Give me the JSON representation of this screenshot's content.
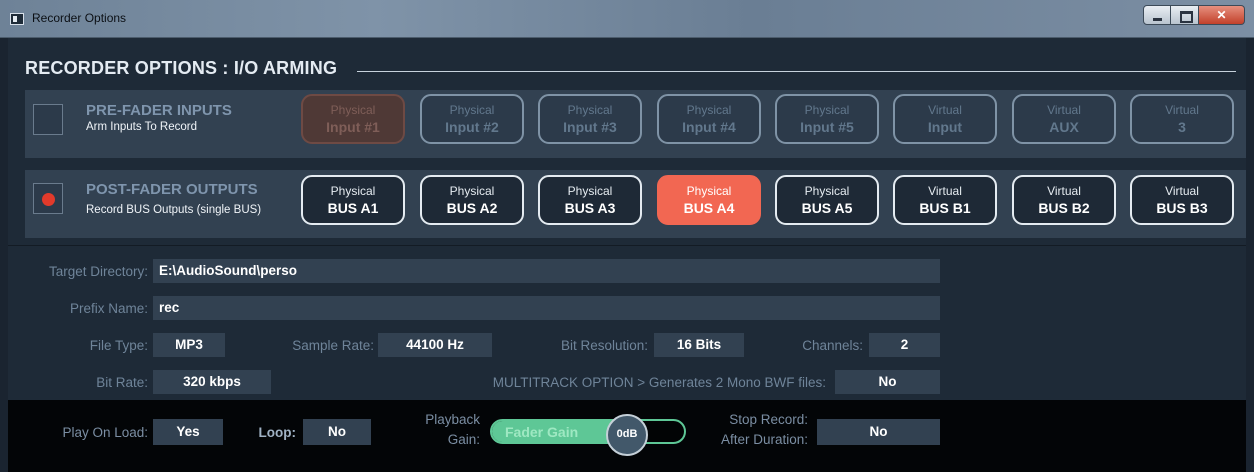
{
  "window": {
    "title": "Recorder Options"
  },
  "header": "RECORDER OPTIONS : I/O ARMING",
  "pre_fader": {
    "title": "PRE-FADER INPUTS",
    "subtitle": "Arm Inputs To Record",
    "armed": false,
    "buttons": [
      {
        "line1": "Physical",
        "line2": "Input #1",
        "state": "dim-red"
      },
      {
        "line1": "Physical",
        "line2": "Input #2",
        "state": "disabled"
      },
      {
        "line1": "Physical",
        "line2": "Input #3",
        "state": "disabled"
      },
      {
        "line1": "Physical",
        "line2": "Input #4",
        "state": "disabled"
      },
      {
        "line1": "Physical",
        "line2": "Input #5",
        "state": "disabled"
      },
      {
        "line1": "Virtual",
        "line2": "Input",
        "state": "disabled"
      },
      {
        "line1": "Virtual",
        "line2": "AUX",
        "state": "disabled"
      },
      {
        "line1": "Virtual",
        "line2": "3",
        "state": "disabled"
      }
    ]
  },
  "post_fader": {
    "title": "POST-FADER OUTPUTS",
    "subtitle": "Record BUS Outputs (single BUS)",
    "armed": true,
    "buttons": [
      {
        "line1": "Physical",
        "line2": "BUS A1",
        "state": "normal"
      },
      {
        "line1": "Physical",
        "line2": "BUS A2",
        "state": "normal"
      },
      {
        "line1": "Physical",
        "line2": "BUS A3",
        "state": "normal"
      },
      {
        "line1": "Physical",
        "line2": "BUS A4",
        "state": "active"
      },
      {
        "line1": "Physical",
        "line2": "BUS A5",
        "state": "normal"
      },
      {
        "line1": "Virtual",
        "line2": "BUS B1",
        "state": "normal"
      },
      {
        "line1": "Virtual",
        "line2": "BUS B2",
        "state": "normal"
      },
      {
        "line1": "Virtual",
        "line2": "BUS B3",
        "state": "normal"
      }
    ]
  },
  "settings": {
    "target_directory": {
      "label": "Target Directory:",
      "value": "E:\\AudioSound\\perso"
    },
    "prefix_name": {
      "label": "Prefix Name:",
      "value": "rec"
    },
    "file_type": {
      "label": "File Type:",
      "value": "MP3"
    },
    "sample_rate": {
      "label": "Sample Rate:",
      "value": "44100 Hz"
    },
    "bit_resolution": {
      "label": "Bit Resolution:",
      "value": "16 Bits"
    },
    "channels": {
      "label": "Channels:",
      "value": "2"
    },
    "bit_rate": {
      "label": "Bit Rate:",
      "value": "320 kbps"
    },
    "multitrack": {
      "label": "MULTITRACK OPTION > Generates 2 Mono BWF files:",
      "value": "No"
    }
  },
  "playback": {
    "play_on_load": {
      "label": "Play On Load:",
      "value": "Yes"
    },
    "loop": {
      "label": "Loop:",
      "value": "No"
    },
    "gain": {
      "label_line1": "Playback",
      "label_line2": "Gain:",
      "fader_label": "Fader Gain",
      "value": "0dB",
      "level": 0.7
    },
    "stop_record": {
      "label_line1": "Stop Record:",
      "label_line2": "After Duration:",
      "value": "No"
    }
  },
  "colors": {
    "active_bus": "#f26752",
    "record_dot": "#e23a2b",
    "fader": "#5ec796"
  }
}
